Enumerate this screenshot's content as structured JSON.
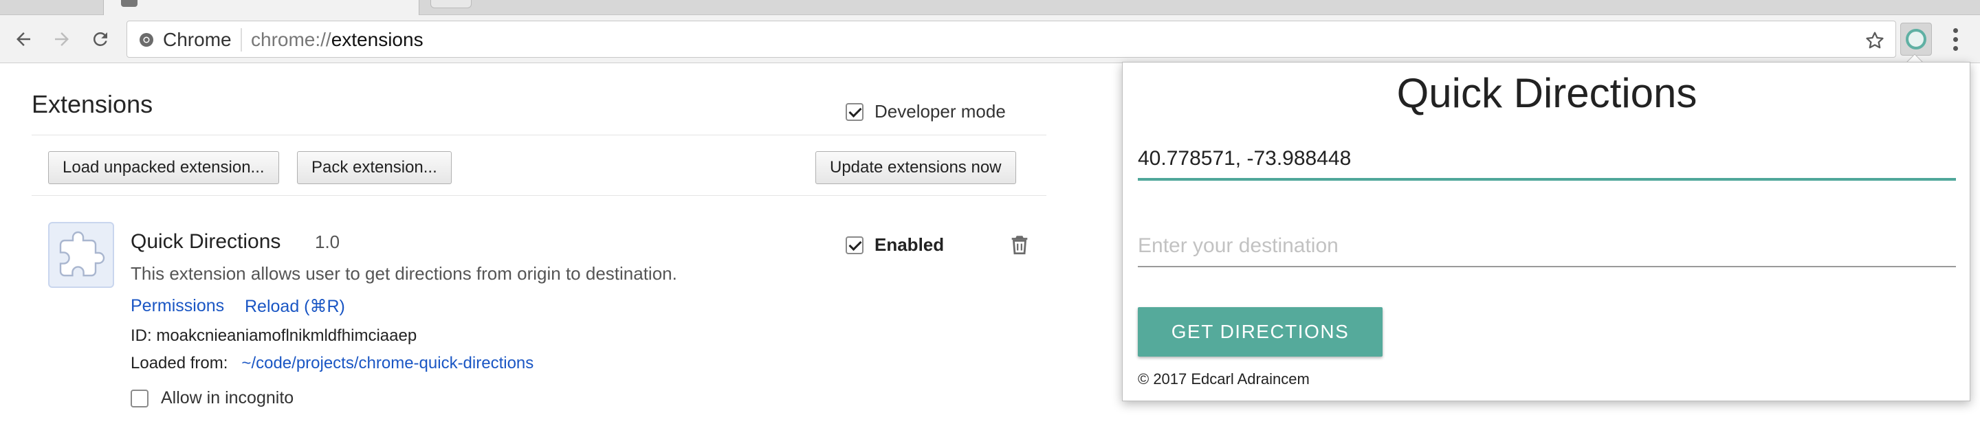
{
  "browser": {
    "origin_chip": "Chrome",
    "url_scheme": "chrome://",
    "url_path": "extensions",
    "icons": {
      "back": "back-arrow-icon",
      "forward": "forward-arrow-icon",
      "reload": "reload-icon",
      "secure": "chrome-page-icon",
      "bookmark": "star-icon",
      "menu": "kebab-menu-icon",
      "extension_action": "quick-directions-extension-icon"
    }
  },
  "extensions_page": {
    "title": "Extensions",
    "developer_mode": {
      "label": "Developer mode",
      "checked": true
    },
    "buttons": {
      "load_unpacked": "Load unpacked extension...",
      "pack": "Pack extension...",
      "update": "Update extensions now"
    },
    "extension": {
      "name": "Quick Directions",
      "version": "1.0",
      "description": "This extension allows user to get directions from origin to destination.",
      "permissions_link": "Permissions",
      "reload_link": "Reload (⌘R)",
      "id_label": "ID:",
      "id_value": "moakcnieaniamoflnikmldfhimciaaep",
      "loaded_from_label": "Loaded from:",
      "loaded_from_path": "~/code/projects/chrome-quick-directions",
      "allow_incognito": {
        "label": "Allow in incognito",
        "checked": false
      },
      "enabled": {
        "label": "Enabled",
        "checked": true
      }
    }
  },
  "popup": {
    "title": "Quick Directions",
    "origin_value": "40.778571, -73.988448",
    "destination_placeholder": "Enter your destination",
    "destination_value": "",
    "submit_label": "GET DIRECTIONS",
    "footer": "© 2017 Edcarl Adraincem",
    "accent_color": "#55aa9b"
  }
}
